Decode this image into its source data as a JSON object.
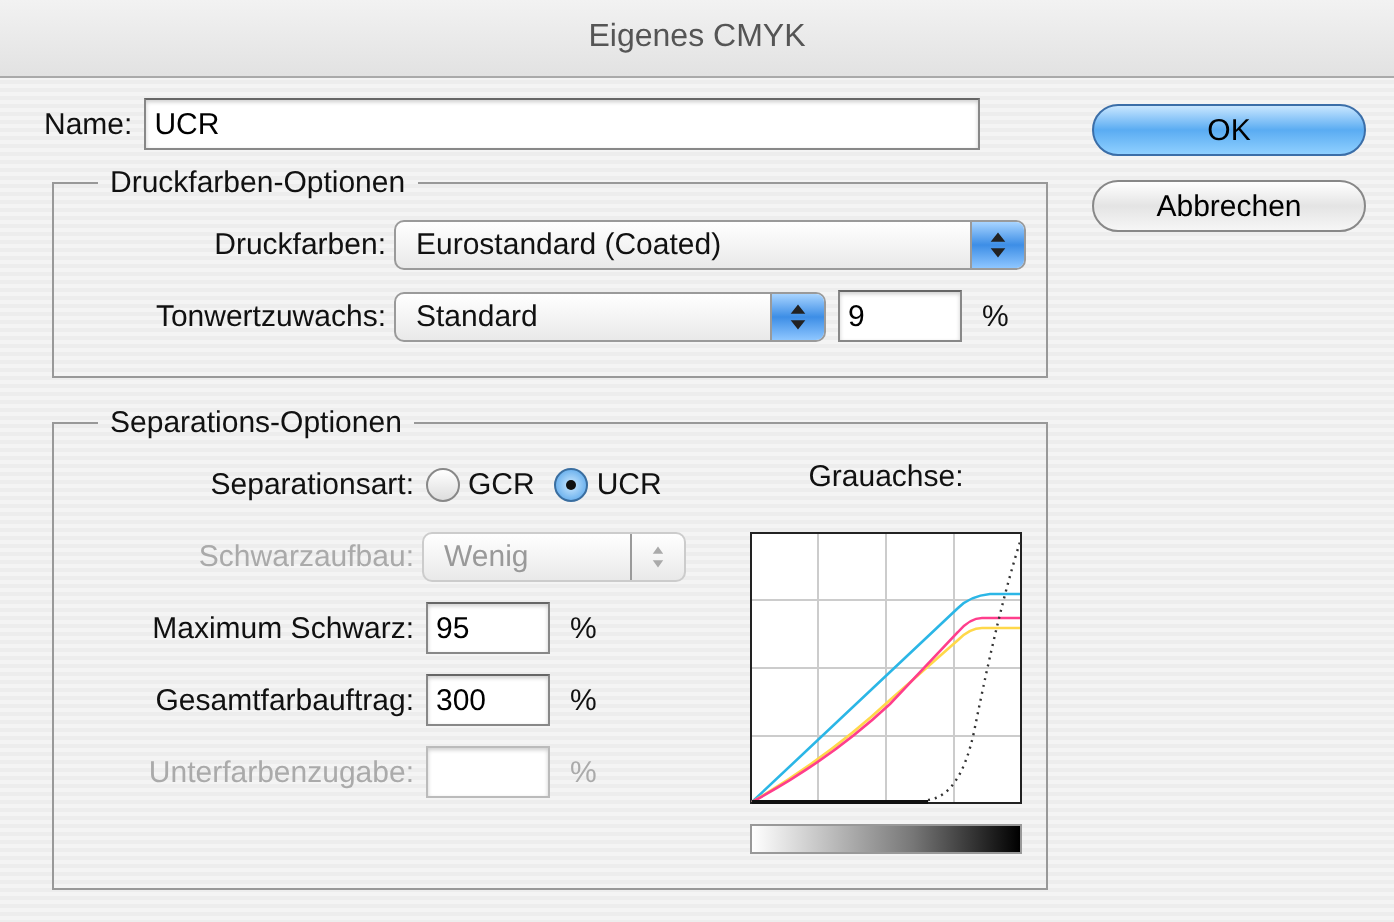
{
  "window": {
    "title": "Eigenes CMYK"
  },
  "name_field": {
    "label": "Name:",
    "value": "UCR"
  },
  "buttons": [
    {
      "label": "OK",
      "default": true
    },
    {
      "label": "Abbrechen",
      "default": false
    }
  ],
  "ink_options": {
    "title": "Druckfarben-Optionen",
    "inks": {
      "label": "Druckfarben:",
      "value": "Eurostandard (Coated)"
    },
    "dot_gain": {
      "label": "Tonwertzuwachs:",
      "value": "Standard",
      "number": "9",
      "unit": "%"
    }
  },
  "separation_options": {
    "title": "Separations-Optionen",
    "type": {
      "label": "Separationsart:",
      "options": [
        {
          "label": "GCR",
          "selected": false
        },
        {
          "label": "UCR",
          "selected": true
        }
      ]
    },
    "black_generation": {
      "label": "Schwarzaufbau:",
      "value": "Wenig",
      "disabled": true
    },
    "fields": [
      {
        "label": "Maximum Schwarz:",
        "value": "95",
        "unit": "%",
        "disabled": false
      },
      {
        "label": "Gesamtfarbauftrag:",
        "value": "300",
        "unit": "%",
        "disabled": false
      },
      {
        "label": "Unterfarbenzugabe:",
        "unit": "%",
        "disabled": true
      }
    ],
    "graph_label": "Grauachse:"
  }
}
